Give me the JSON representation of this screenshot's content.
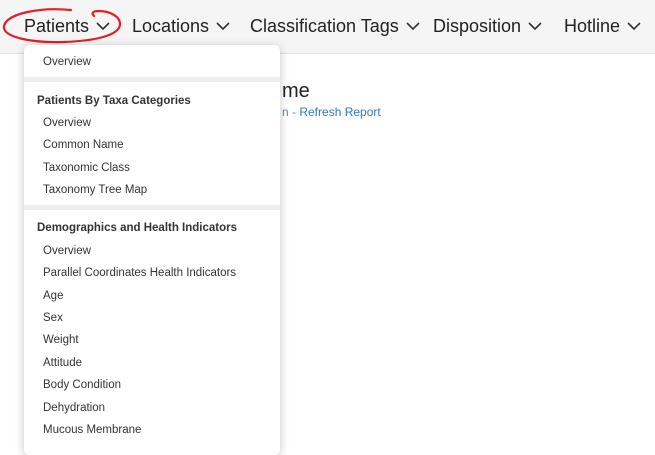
{
  "nav": {
    "items": [
      {
        "label": "Patients"
      },
      {
        "label": "Locations"
      },
      {
        "label": "Classification Tags"
      },
      {
        "label": "Disposition"
      },
      {
        "label": "Hotline"
      }
    ]
  },
  "page": {
    "title_fragment": "me",
    "subtitle_lead": "n - ",
    "refresh_link": "Refresh Report"
  },
  "dropdown": {
    "top_item": "Overview",
    "sections": [
      {
        "header": "Patients By Taxa Categories",
        "items": [
          "Overview",
          "Common Name",
          "Taxonomic Class",
          "Taxonomy Tree Map"
        ]
      },
      {
        "header": "Demographics and Health Indicators",
        "items": [
          "Overview",
          "Parallel Coordinates Health Indicators",
          "Age",
          "Sex",
          "Weight",
          "Attitude",
          "Body Condition",
          "Dehydration",
          "Mucous Membrane"
        ]
      }
    ]
  },
  "colors": {
    "annotation": "#e0202a",
    "link": "#2f7bbf",
    "navbar_bg": "#f5f5f5"
  }
}
